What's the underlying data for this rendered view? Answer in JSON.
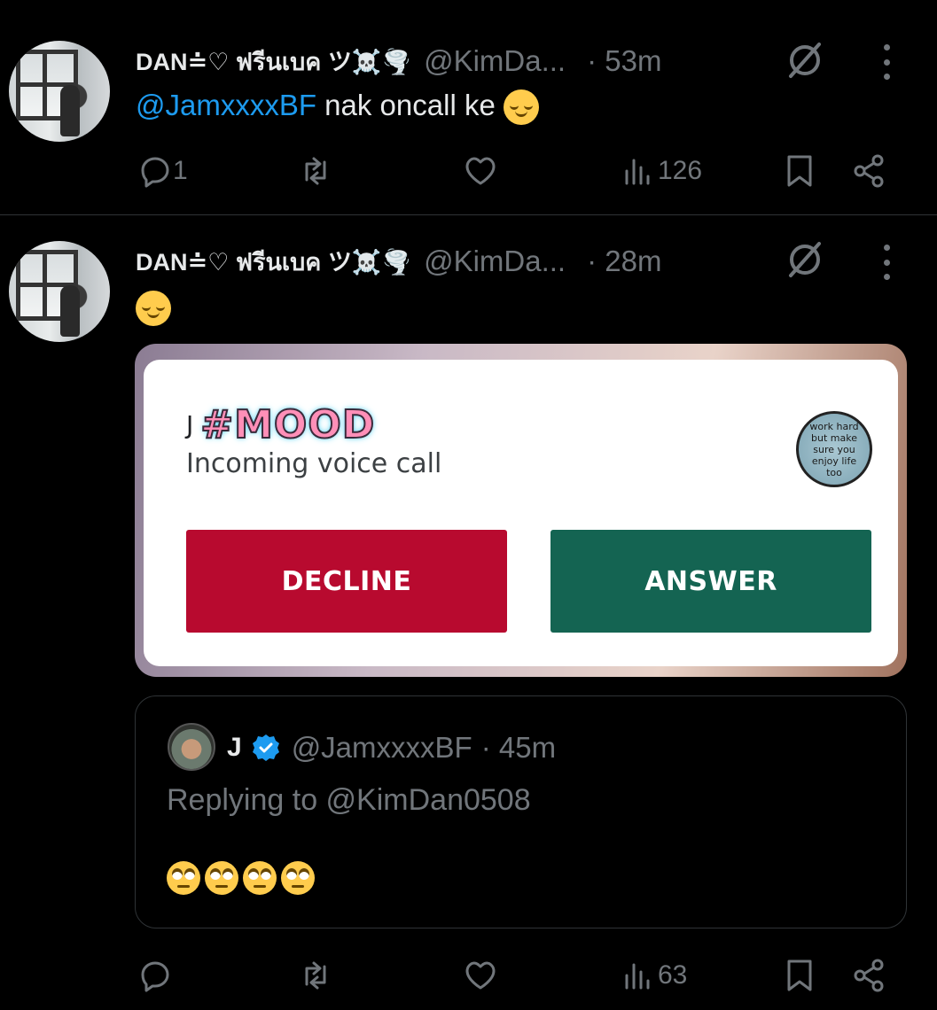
{
  "tweet1": {
    "display_name": "DAN≐♡ ฟรีนเบค ツ☠️🌪️",
    "handle": "@KimDa...",
    "time": "· 53m",
    "mention": "@JamxxxxBF",
    "text": " nak oncall ke ",
    "emoji": "relieved-face",
    "stats": {
      "replies": "1",
      "reposts": "",
      "likes": "",
      "views": "126"
    }
  },
  "tweet2": {
    "display_name": "DAN≐♡ ฟรีนเบค ツ☠️🌪️",
    "handle": "@KimDa...",
    "time": "· 28m",
    "emoji": "relieved-face",
    "media": {
      "caller_initial": "J",
      "caller_tag": "#MOOD",
      "subtitle": "Incoming voice call",
      "avatar_text": "work hard but make sure you enjoy life too",
      "decline_label": "DECLINE",
      "answer_label": "ANSWER",
      "colors": {
        "decline": "#b80a2f",
        "answer": "#146452"
      }
    },
    "quote": {
      "name": "J",
      "handle": "@JamxxxxBF",
      "time": "· 45m",
      "replying_to": "Replying to @KimDan0508",
      "emojis": [
        "face-with-rolling-eyes",
        "face-with-rolling-eyes",
        "face-with-rolling-eyes",
        "face-with-rolling-eyes"
      ]
    },
    "stats": {
      "replies": "",
      "reposts": "",
      "likes": "",
      "views": "63"
    }
  },
  "colors": {
    "background": "#000000",
    "mention": "#1d9bf0",
    "muted": "#71767b",
    "verified": "#1d9bf0"
  }
}
